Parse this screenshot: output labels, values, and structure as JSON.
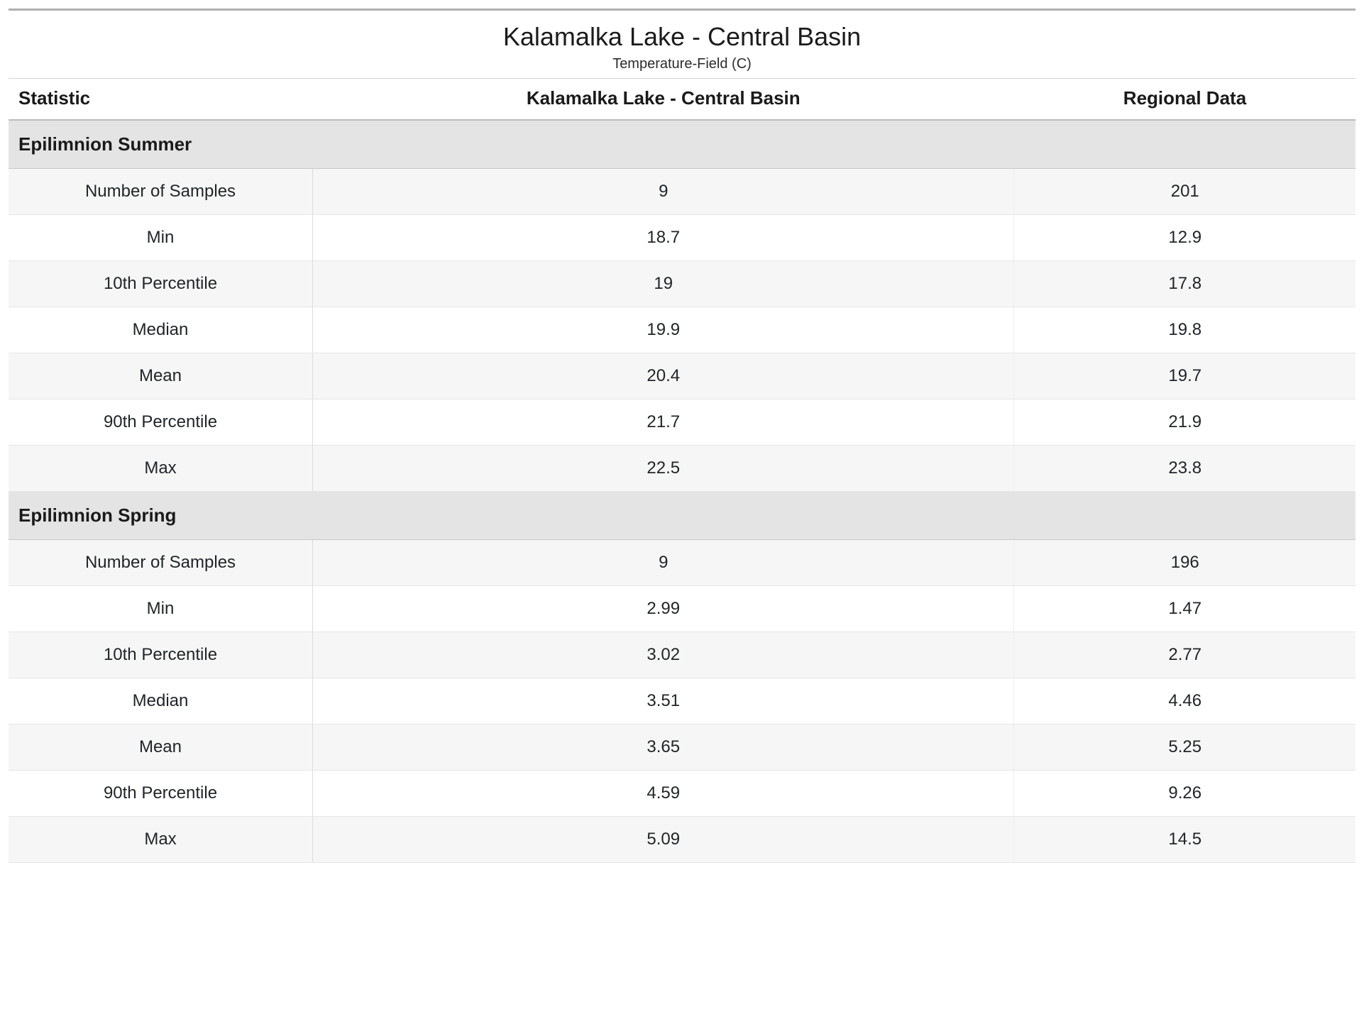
{
  "header": {
    "title": "Kalamalka Lake - Central Basin",
    "subtitle": "Temperature-Field (C)"
  },
  "columns": {
    "stat": "Statistic",
    "local": "Kalamalka Lake - Central Basin",
    "regional": "Regional Data"
  },
  "sections": [
    {
      "title": "Epilimnion Summer",
      "rows": [
        {
          "stat": "Number of Samples",
          "local": "9",
          "regional": "201"
        },
        {
          "stat": "Min",
          "local": "18.7",
          "regional": "12.9"
        },
        {
          "stat": "10th Percentile",
          "local": "19",
          "regional": "17.8"
        },
        {
          "stat": "Median",
          "local": "19.9",
          "regional": "19.8"
        },
        {
          "stat": "Mean",
          "local": "20.4",
          "regional": "19.7"
        },
        {
          "stat": "90th Percentile",
          "local": "21.7",
          "regional": "21.9"
        },
        {
          "stat": "Max",
          "local": "22.5",
          "regional": "23.8"
        }
      ]
    },
    {
      "title": "Epilimnion Spring",
      "rows": [
        {
          "stat": "Number of Samples",
          "local": "9",
          "regional": "196"
        },
        {
          "stat": "Min",
          "local": "2.99",
          "regional": "1.47"
        },
        {
          "stat": "10th Percentile",
          "local": "3.02",
          "regional": "2.77"
        },
        {
          "stat": "Median",
          "local": "3.51",
          "regional": "4.46"
        },
        {
          "stat": "Mean",
          "local": "3.65",
          "regional": "5.25"
        },
        {
          "stat": "90th Percentile",
          "local": "4.59",
          "regional": "9.26"
        },
        {
          "stat": "Max",
          "local": "5.09",
          "regional": "14.5"
        }
      ]
    }
  ]
}
